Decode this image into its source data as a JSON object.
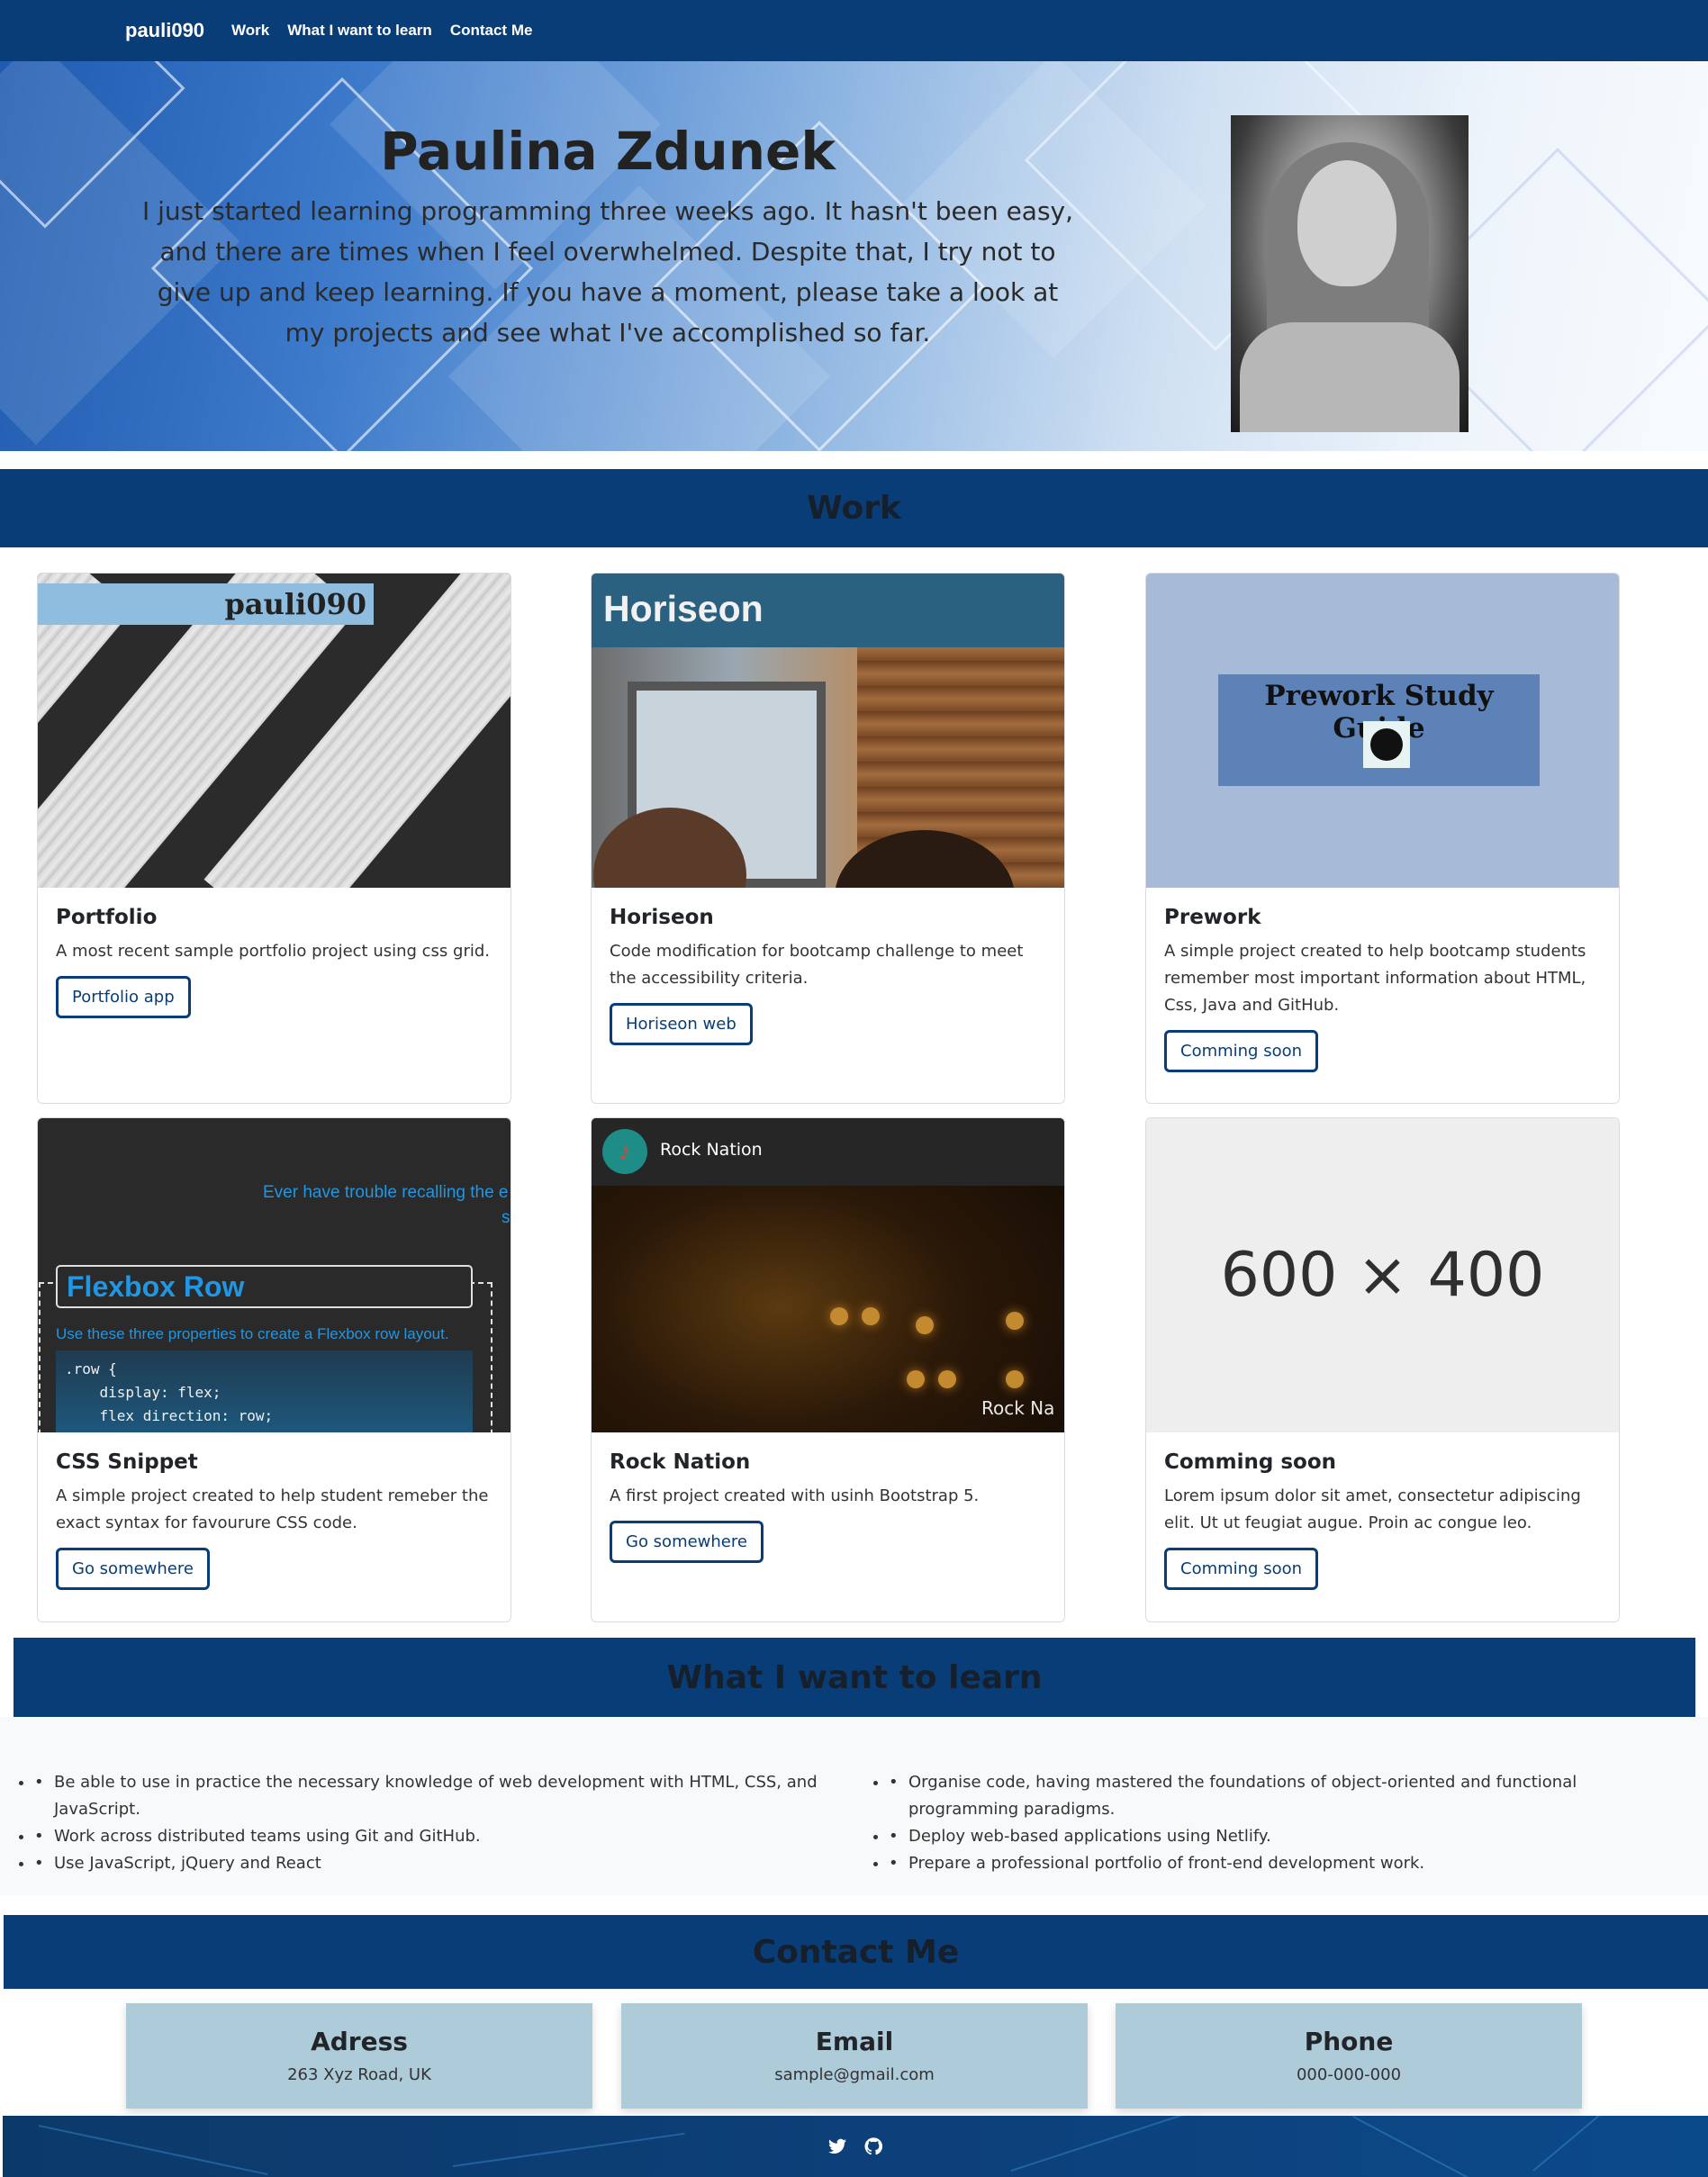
{
  "navbar": {
    "brand": "pauli090",
    "links": [
      "Work",
      "What I want to learn",
      "Contact Me"
    ]
  },
  "hero": {
    "name": "Paulina Zdunek",
    "bio": "I just started learning programming three weeks ago. It hasn't been easy, and there are times when I feel overwhelmed. Despite that, I try not to give up and keep learning. If you have a moment, please take a look at my projects and see what I've accomplished so far."
  },
  "work": {
    "title": "Work",
    "cards": [
      {
        "title": "Portfolio",
        "text": "A most recent sample portfolio project using css grid.",
        "button": "Portfolio app",
        "image_text": "pauli090"
      },
      {
        "title": "Horiseon",
        "text": "Code modification for bootcamp challenge to meet the accessibility criteria.",
        "button": "Horiseon web",
        "image_text": "Horiseon"
      },
      {
        "title": "Prework",
        "text": "A simple project created to help bootcamp students remember most important information about HTML, Css, Java and GitHub.",
        "button": "Comming soon",
        "image_text": "Prework Study Guide"
      },
      {
        "title": "CSS Snippet",
        "text": "A simple project created to help student remeber the exact syntax for favourure CSS code.",
        "button": "Go somewhere",
        "image_question": "Ever have trouble recalling the e",
        "image_question_tail": "s",
        "image_title": "Flexbox Row",
        "image_subtitle": "Use these three properties to create a Flexbox row layout.",
        "image_code": [
          ".row {",
          "    display: flex;",
          "    flex direction: row;"
        ]
      },
      {
        "title": "Rock Nation",
        "text": "A first project created with usinh Bootstrap 5.",
        "button": "Go somewhere",
        "image_text": "Rock Nation",
        "image_watermark": "Rock Na"
      },
      {
        "title": "Comming soon",
        "text": "Lorem ipsum dolor sit amet, consectetur adipiscing elit. Ut ut feugiat augue. Proin ac congue leo.",
        "button": "Comming soon",
        "image_text": "600 × 400"
      }
    ]
  },
  "learn": {
    "title": "What I want to learn",
    "left": [
      "Be able to use in practice the necessary knowledge of web development with HTML, CSS, and JavaScript.",
      "Work across distributed teams using Git and GitHub.",
      "Use JavaScript, jQuery and React"
    ],
    "right": [
      "Organise code, having mastered the foundations of object-oriented and functional programming paradigms.",
      "Deploy web-based applications using Netlify.",
      "Prepare a professional portfolio of front-end development work."
    ]
  },
  "contact": {
    "title": "Contact Me",
    "items": [
      {
        "label": "Adress",
        "value": "263 Xyz Road, UK"
      },
      {
        "label": "Email",
        "value": "sample@gmail.com"
      },
      {
        "label": "Phone",
        "value": "000-000-000"
      }
    ]
  },
  "footer": {
    "icons": [
      "twitter-icon",
      "github-icon"
    ]
  },
  "colors": {
    "primary": "#083d77",
    "contact_card": "#aecbda",
    "learn_bg": "#f8f9fa"
  }
}
